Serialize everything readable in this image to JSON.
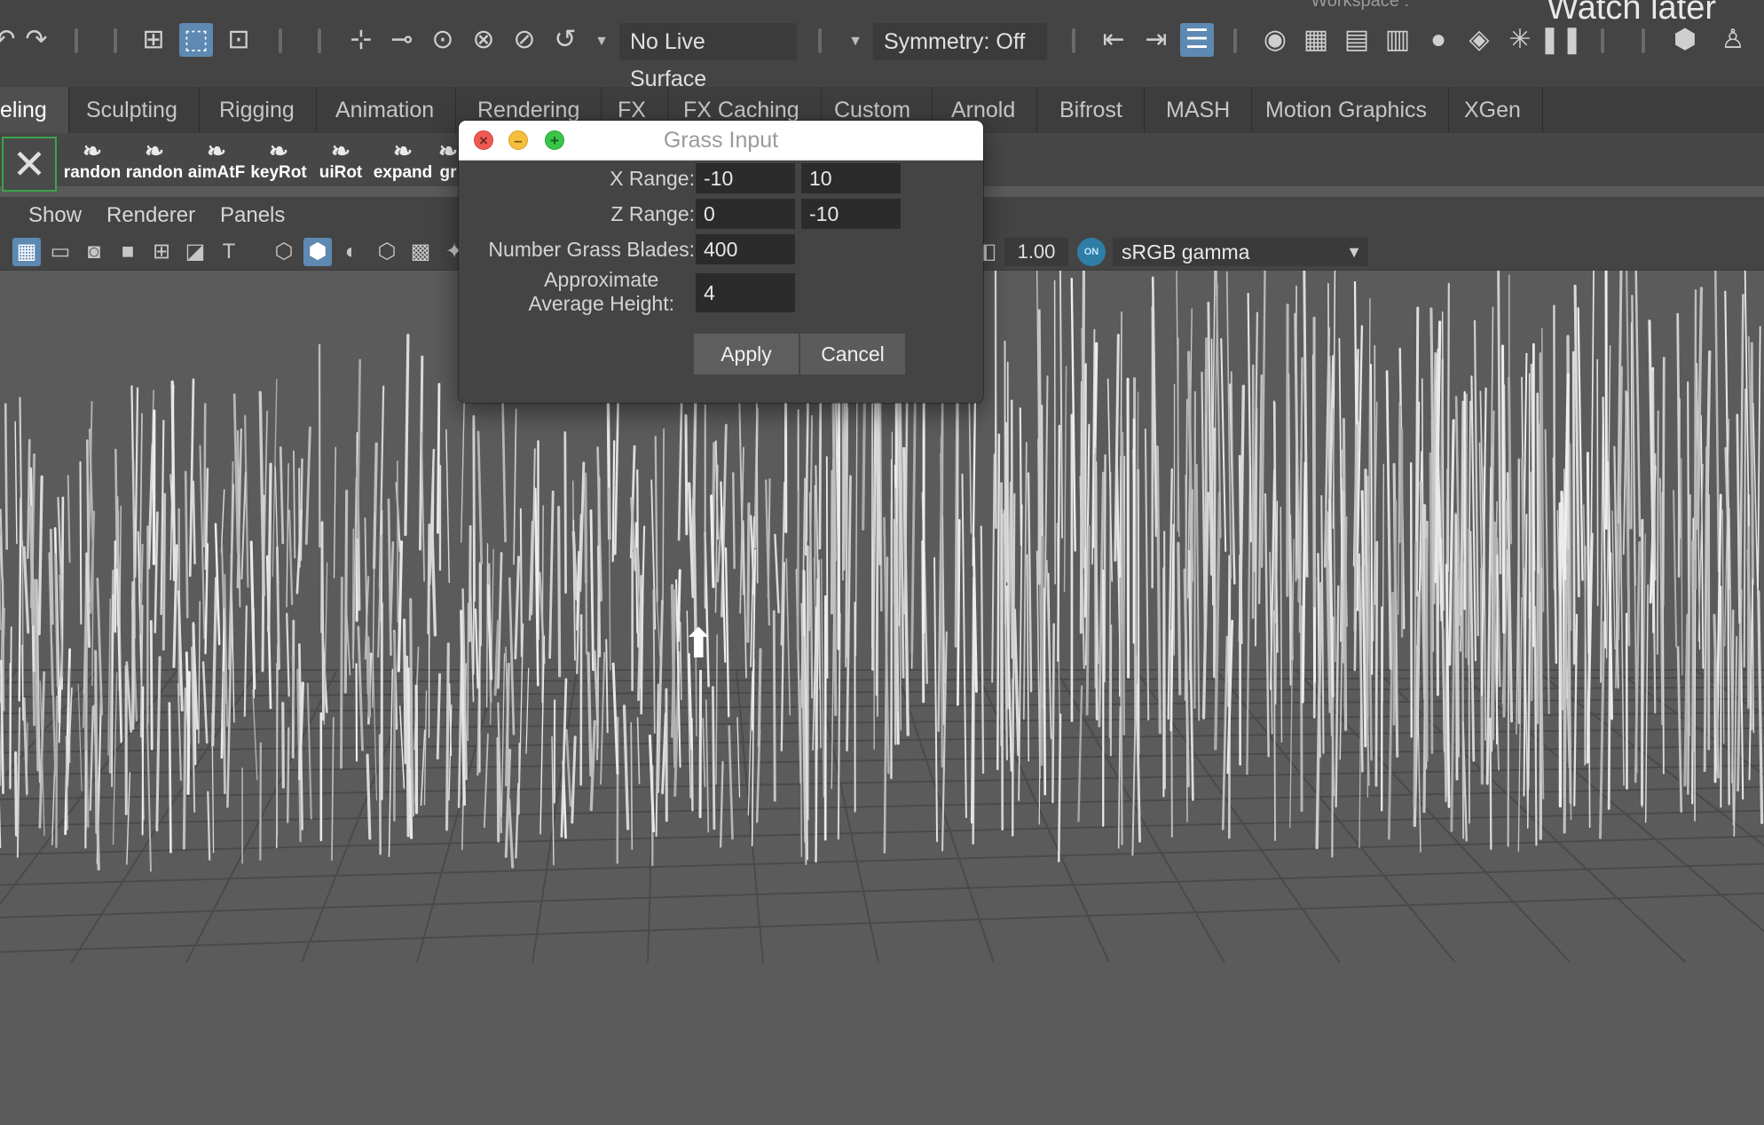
{
  "topbar": {
    "live_surface": "No Live Surface",
    "symmetry": "Symmetry: Off",
    "workspace": "Workspace :",
    "overlay_text": "Watch later"
  },
  "shelf": {
    "tabs": [
      "eling",
      "Sculpting",
      "Rigging",
      "Animation",
      "Rendering",
      "FX",
      "FX Caching",
      "Custom",
      "Arnold",
      "Bifrost",
      "MASH",
      "Motion Graphics",
      "XGen"
    ],
    "buttons": [
      "randon",
      "randon",
      "aimAtF",
      "keyRot",
      "uiRot",
      "expand",
      "gr"
    ]
  },
  "panel": {
    "menus": [
      "Show",
      "Renderer",
      "Panels"
    ],
    "gamma_value": "1.00",
    "cm_toggle": "ON",
    "color_space": "sRGB gamma"
  },
  "dialog": {
    "title": "Grass Input",
    "x_range_label": "X Range:",
    "x_range_min": "-10",
    "x_range_max": "10",
    "z_range_label": "Z Range:",
    "z_range_min": "0",
    "z_range_max": "-10",
    "blades_label": "Number Grass Blades:",
    "blades_value": "400",
    "height_label_line1": "Approximate",
    "height_label_line2": "Average Height:",
    "height_value": "4",
    "apply_label": "Apply",
    "cancel_label": "Cancel"
  },
  "icons": {
    "close": "close-icon",
    "minimize": "minimize-icon",
    "maximize": "maximize-icon"
  }
}
